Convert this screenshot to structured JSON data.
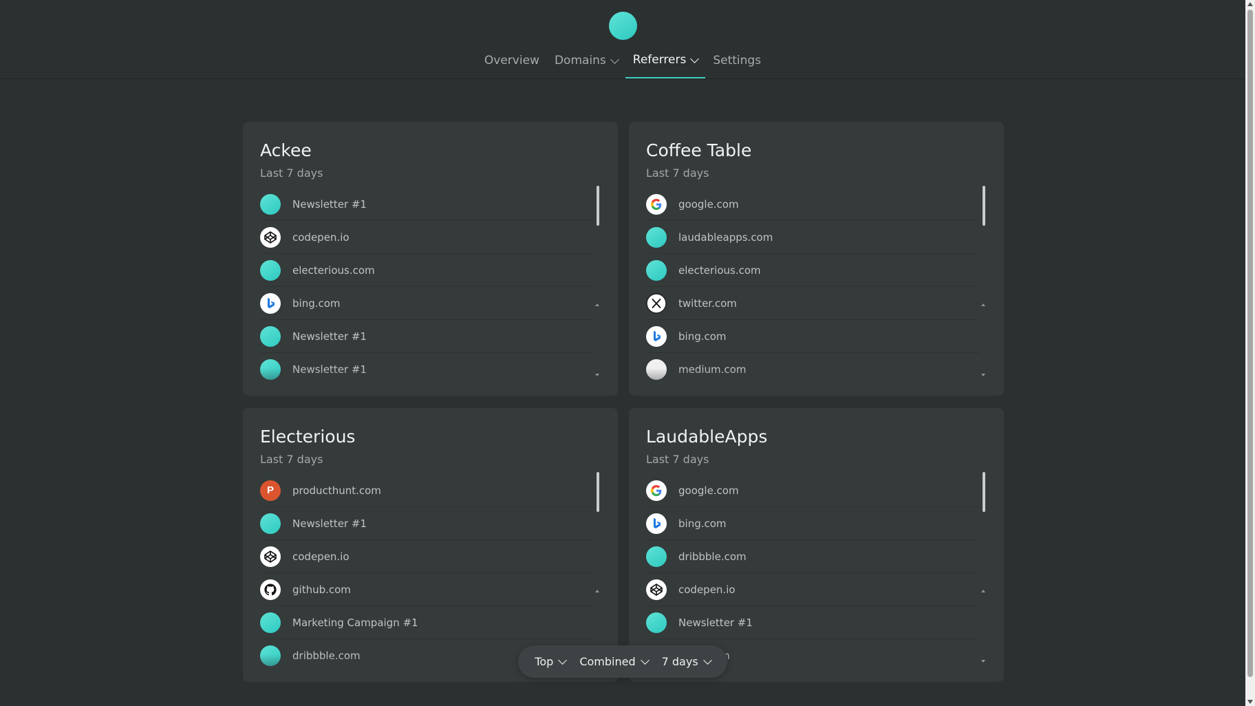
{
  "nav": {
    "items": [
      {
        "label": "Overview",
        "icon": null,
        "active": false
      },
      {
        "label": "Domains",
        "icon": "chevron-down-icon",
        "active": false
      },
      {
        "label": "Referrers",
        "icon": "chevron-down-icon",
        "active": true
      },
      {
        "label": "Settings",
        "icon": null,
        "active": false
      }
    ]
  },
  "cards": [
    {
      "title": "Ackee",
      "subtitle": "Last 7 days",
      "rows": [
        {
          "label": "Newsletter #1",
          "icon": "teal"
        },
        {
          "label": "codepen.io",
          "icon": "codepen"
        },
        {
          "label": "electerious.com",
          "icon": "teal"
        },
        {
          "label": "bing.com",
          "icon": "bing"
        },
        {
          "label": "Newsletter #1",
          "icon": "teal"
        },
        {
          "label": "Newsletter #1",
          "icon": "teal"
        }
      ]
    },
    {
      "title": "Coffee Table",
      "subtitle": "Last 7 days",
      "rows": [
        {
          "label": "google.com",
          "icon": "google"
        },
        {
          "label": "laudableapps.com",
          "icon": "teal"
        },
        {
          "label": "electerious.com",
          "icon": "teal"
        },
        {
          "label": "twitter.com",
          "icon": "x"
        },
        {
          "label": "bing.com",
          "icon": "bing"
        },
        {
          "label": "medium.com",
          "icon": "medium"
        }
      ]
    },
    {
      "title": "Electerious",
      "subtitle": "Last 7 days",
      "rows": [
        {
          "label": "producthunt.com",
          "icon": "producthunt"
        },
        {
          "label": "Newsletter #1",
          "icon": "teal"
        },
        {
          "label": "codepen.io",
          "icon": "codepen"
        },
        {
          "label": "github.com",
          "icon": "github"
        },
        {
          "label": "Marketing Campaign #1",
          "icon": "teal"
        },
        {
          "label": "dribbble.com",
          "icon": "teal"
        }
      ]
    },
    {
      "title": "LaudableApps",
      "subtitle": "Last 7 days",
      "rows": [
        {
          "label": "google.com",
          "icon": "google"
        },
        {
          "label": "bing.com",
          "icon": "bing"
        },
        {
          "label": "dribbble.com",
          "icon": "teal"
        },
        {
          "label": "codepen.io",
          "icon": "codepen"
        },
        {
          "label": "Newsletter #1",
          "icon": "teal"
        },
        {
          "label": "…tes.com",
          "icon": "teal"
        }
      ]
    }
  ],
  "bottom_bar": {
    "sorting": "Top",
    "type": "Combined",
    "range": "7 days"
  },
  "colors": {
    "accent": "#3ed0c4",
    "background": "#2b3031",
    "card": "#353a3b"
  }
}
